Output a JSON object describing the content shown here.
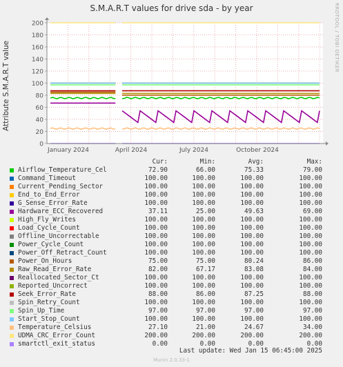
{
  "chart_data": {
    "type": "line",
    "title": "S.M.A.R.T values for drive sda - by year",
    "ylabel": "Attribute S.M.A.R.T value",
    "ylim": [
      0,
      200
    ],
    "yticks": [
      0,
      20,
      40,
      60,
      80,
      100,
      120,
      140,
      160,
      180,
      200
    ],
    "xticks": [
      "January 2024",
      "April 2024",
      "July 2024",
      "October 2024"
    ],
    "side_label": "RRDTOOL / TOBI OETIKER",
    "grid": true,
    "legend_headers": [
      "Cur:",
      "Min:",
      "Avg:",
      "Max:"
    ],
    "series": [
      {
        "name": "Airflow_Temperature_Cel",
        "color": "#00cc00",
        "cur": "72.90",
        "min": "66.00",
        "avg": "75.33",
        "max": "79.00",
        "level": 75.3
      },
      {
        "name": "Command_Timeout",
        "color": "#0066b3",
        "cur": "100.00",
        "min": "100.00",
        "avg": "100.00",
        "max": "100.00",
        "level": 100
      },
      {
        "name": "Current_Pending_Sector",
        "color": "#ff8000",
        "cur": "100.00",
        "min": "100.00",
        "avg": "100.00",
        "max": "100.00",
        "level": 100
      },
      {
        "name": "End_to_End_Error",
        "color": "#ffcc00",
        "cur": "100.00",
        "min": "100.00",
        "avg": "100.00",
        "max": "100.00",
        "level": 100
      },
      {
        "name": "G_Sense_Error_Rate",
        "color": "#330099",
        "cur": "100.00",
        "min": "100.00",
        "avg": "100.00",
        "max": "100.00",
        "level": 100
      },
      {
        "name": "Hardware_ECC_Recovered",
        "color": "#990099",
        "cur": "37.11",
        "min": "25.00",
        "avg": "49.63",
        "max": "69.00",
        "level": 49.6
      },
      {
        "name": "High_Fly_Writes",
        "color": "#ccff00",
        "cur": "100.00",
        "min": "100.00",
        "avg": "100.00",
        "max": "100.00",
        "level": 100
      },
      {
        "name": "Load_Cycle_Count",
        "color": "#ff0000",
        "cur": "100.00",
        "min": "100.00",
        "avg": "100.00",
        "max": "100.00",
        "level": 100
      },
      {
        "name": "Offline_Uncorrectable",
        "color": "#808080",
        "cur": "100.00",
        "min": "100.00",
        "avg": "100.00",
        "max": "100.00",
        "level": 100
      },
      {
        "name": "Power_Cycle_Count",
        "color": "#008f00",
        "cur": "100.00",
        "min": "100.00",
        "avg": "100.00",
        "max": "100.00",
        "level": 100
      },
      {
        "name": "Power_Off_Retract_Count",
        "color": "#00487d",
        "cur": "100.00",
        "min": "100.00",
        "avg": "100.00",
        "max": "100.00",
        "level": 100
      },
      {
        "name": "Power_On_Hours",
        "color": "#b35a00",
        "cur": "75.00",
        "min": "75.00",
        "avg": "80.24",
        "max": "86.00",
        "level": 80.2
      },
      {
        "name": "Raw_Read_Error_Rate",
        "color": "#b38f00",
        "cur": "82.00",
        "min": "67.17",
        "avg": "83.08",
        "max": "84.00",
        "level": 83
      },
      {
        "name": "Reallocated_Sector_Ct",
        "color": "#6b006b",
        "cur": "100.00",
        "min": "100.00",
        "avg": "100.00",
        "max": "100.00",
        "level": 100
      },
      {
        "name": "Reported_Uncorrect",
        "color": "#8fb300",
        "cur": "100.00",
        "min": "100.00",
        "avg": "100.00",
        "max": "100.00",
        "level": 100
      },
      {
        "name": "Seek_Error_Rate",
        "color": "#b30000",
        "cur": "88.00",
        "min": "86.00",
        "avg": "87.25",
        "max": "88.00",
        "level": 87.3
      },
      {
        "name": "Spin_Retry_Count",
        "color": "#bebebe",
        "cur": "100.00",
        "min": "100.00",
        "avg": "100.00",
        "max": "100.00",
        "level": 100
      },
      {
        "name": "Spin_Up_Time",
        "color": "#80ff80",
        "cur": "97.00",
        "min": "97.00",
        "avg": "97.00",
        "max": "97.00",
        "level": 97
      },
      {
        "name": "Start_Stop_Count",
        "color": "#80c9ff",
        "cur": "100.00",
        "min": "100.00",
        "avg": "100.00",
        "max": "100.00",
        "level": 100
      },
      {
        "name": "Temperature_Celsius",
        "color": "#ffc080",
        "cur": "27.10",
        "min": "21.00",
        "avg": "24.67",
        "max": "34.00",
        "level": 24.7
      },
      {
        "name": "UDMA_CRC_Error_Count",
        "color": "#ffe680",
        "cur": "200.00",
        "min": "200.00",
        "avg": "200.00",
        "max": "200.00",
        "level": 200
      },
      {
        "name": "smartctl_exit_status",
        "color": "#aa80ff",
        "cur": "0.00",
        "min": "0.00",
        "avg": "0.00",
        "max": "0.00",
        "level": 0
      }
    ]
  },
  "last_update": "Last update:  Wed Jan 15 06:45:00 2025",
  "footer": "Munin 2.0.33-1"
}
